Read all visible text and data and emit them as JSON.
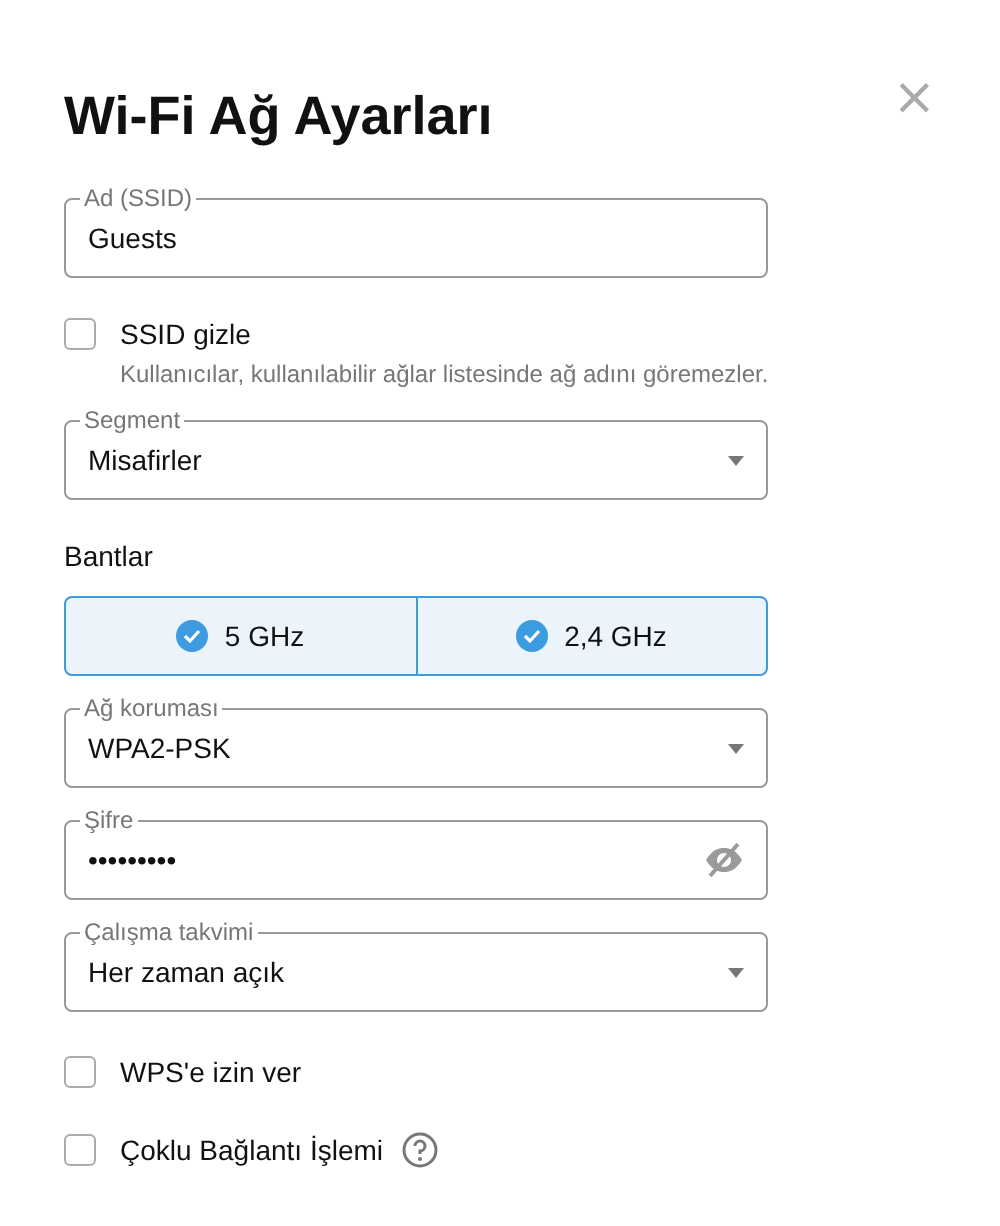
{
  "title": "Wi-Fi Ağ Ayarları",
  "close": "×",
  "fields_top": [
    {
      "kind": "text",
      "label": "Ad (SSID)",
      "value": "Guests"
    }
  ],
  "hide_ssid": {
    "label": "SSID gizle",
    "checked": false,
    "hint": "Kullanıcılar, kullanılabilir ağlar listesinde ağ adını göremezler."
  },
  "segment": [
    {
      "kind": "select",
      "label": "Segment",
      "value": "Misafirler"
    }
  ],
  "bands_label": "Bantlar",
  "bands": [
    {
      "label": "5 GHz",
      "selected": true
    },
    {
      "label": "2,4 GHz",
      "selected": true
    }
  ],
  "fields_bottom": [
    {
      "kind": "select",
      "label": "Ağ koruması",
      "value": "WPA2-PSK"
    },
    {
      "kind": "password",
      "label": "Şifre",
      "value": "•••••••••"
    },
    {
      "kind": "select",
      "label": "Çalışma takvimi",
      "value": "Her zaman açık"
    }
  ],
  "options": [
    {
      "label": "WPS'e izin ver",
      "checked": false,
      "help": false
    },
    {
      "label": "Çoklu Bağlantı İşlemi",
      "checked": false,
      "help": true
    }
  ]
}
